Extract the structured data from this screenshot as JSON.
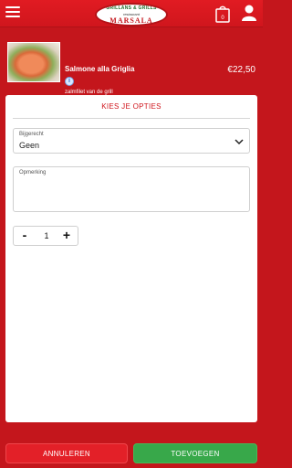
{
  "header": {
    "logo": {
      "line1": "GRILLANS & GRILLS",
      "line2": "restaurant",
      "line3": "MARSALA"
    },
    "cart_count": "0",
    "icons": [
      "menu-icon",
      "cart-icon",
      "user-icon"
    ]
  },
  "product": {
    "title": "Salmone alla Griglia",
    "price": "€22,50",
    "info_glyph": "i",
    "description": "zalmfilet van de grill"
  },
  "options": {
    "heading": "KIES JE OPTIES",
    "side_label": "Bijgerecht",
    "side_value": "Geen",
    "remark_label": "Opmerking",
    "remark_value": "",
    "quantity": "1",
    "minus": "-",
    "plus": "+"
  },
  "footer": {
    "cancel_label": "ANNULEREN",
    "add_label": "TOEVOEGEN"
  },
  "colors": {
    "brand_red": "#c4161c",
    "add_green": "#38a84a"
  }
}
